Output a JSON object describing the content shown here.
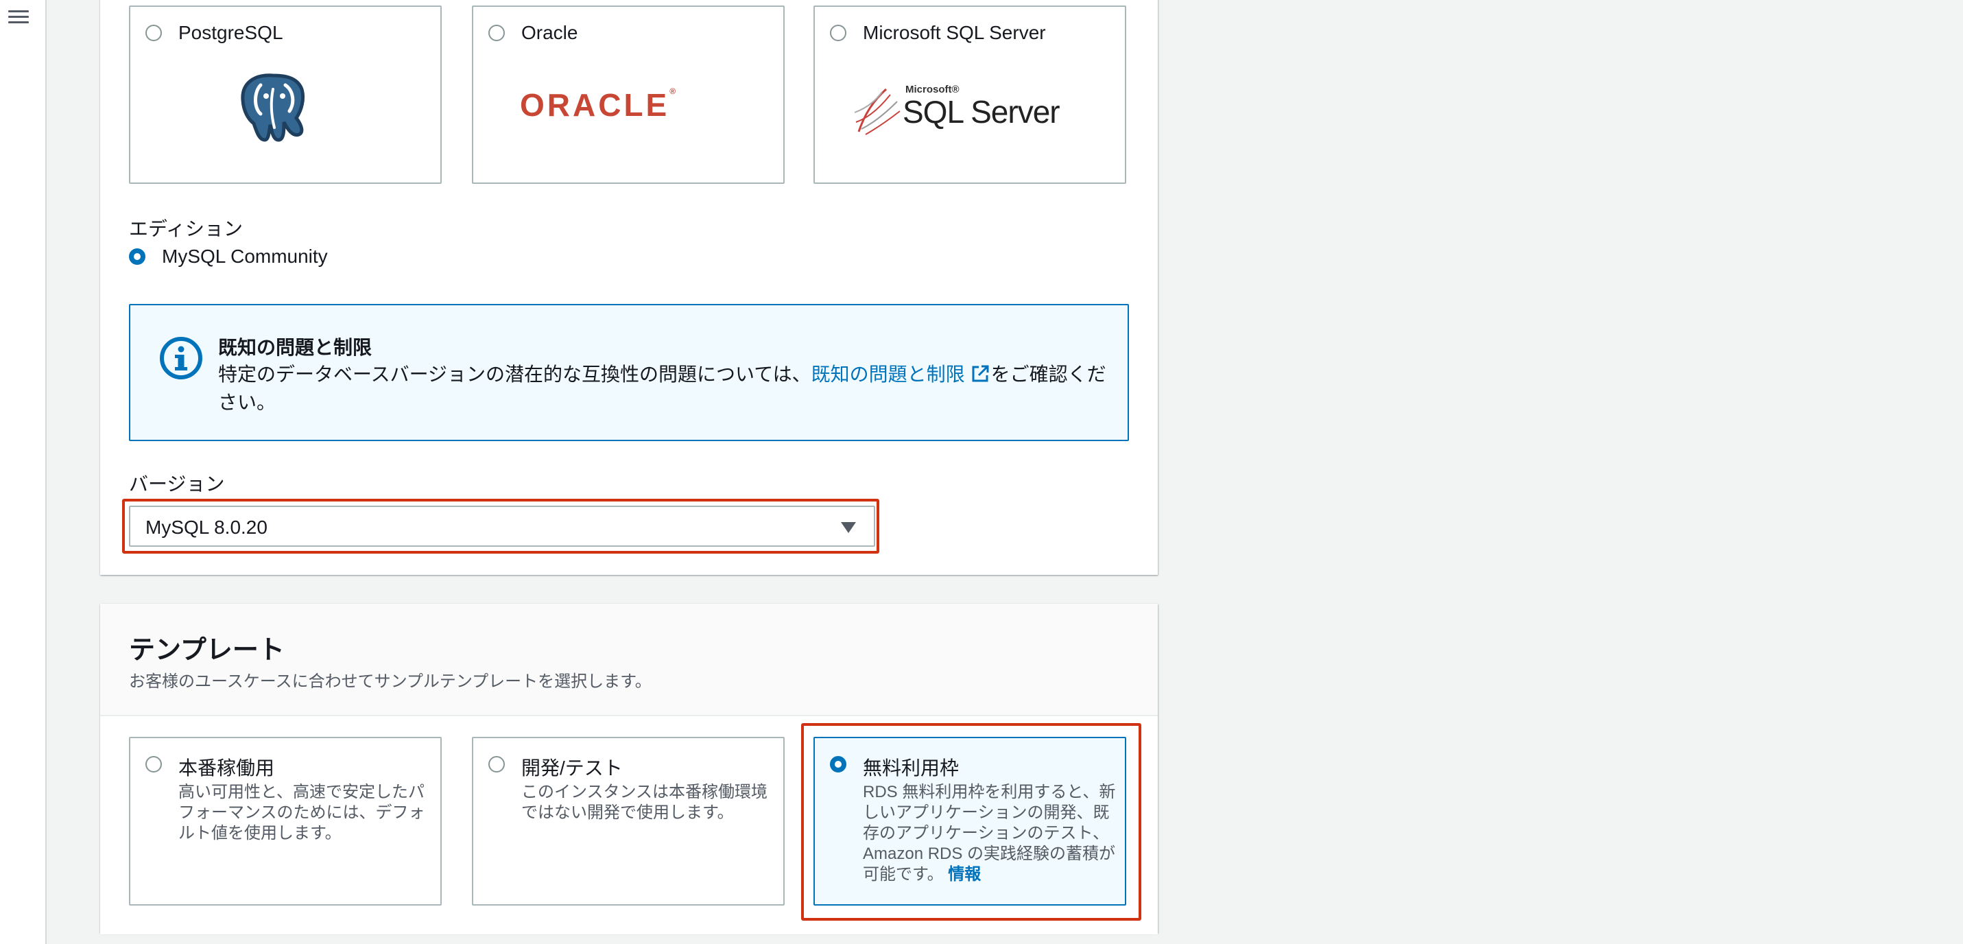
{
  "engines": [
    {
      "label": "PostgreSQL",
      "logo": "postgresql-elephant-logo",
      "selected": false
    },
    {
      "label": "Oracle",
      "logo_text": "ORACLE",
      "selected": false
    },
    {
      "label": "Microsoft SQL Server",
      "logo_small": "Microsoft®",
      "logo_text": "SQL Server",
      "selected": false
    }
  ],
  "edition": {
    "label": "エディション",
    "option": "MySQL Community",
    "selected": true
  },
  "alert": {
    "title": "既知の問題と制限",
    "body_before": "特定のデータベースバージョンの潜在的な互換性の問題については、",
    "link": "既知の問題と制限",
    "body_after": "をご確認ください。",
    "icon": "info-icon"
  },
  "version": {
    "label": "バージョン",
    "value": "MySQL 8.0.20"
  },
  "templates": {
    "title": "テンプレート",
    "description": "お客様のユースケースに合わせてサンプルテンプレートを選択します。",
    "options": [
      {
        "title": "本番稼働用",
        "desc": "高い可用性と、高速で安定したパフォーマンスのためには、デフォルト値を使用します。",
        "selected": false
      },
      {
        "title": "開発/テスト",
        "desc": "このインスタンスは本番稼働環境ではない開発で使用します。",
        "selected": false
      },
      {
        "title": "無料利用枠",
        "desc": "RDS 無料利用枠を利用すると、新しいアプリケーションの開発、既存のアプリケーションのテスト、Amazon RDS の実践経験の蓄積が可能です。",
        "link": "情報",
        "selected": true
      }
    ]
  },
  "colors": {
    "accent": "#0073bb",
    "highlight": "#d13212",
    "oracle_red": "#c74634",
    "postgres_blue": "#336791"
  }
}
